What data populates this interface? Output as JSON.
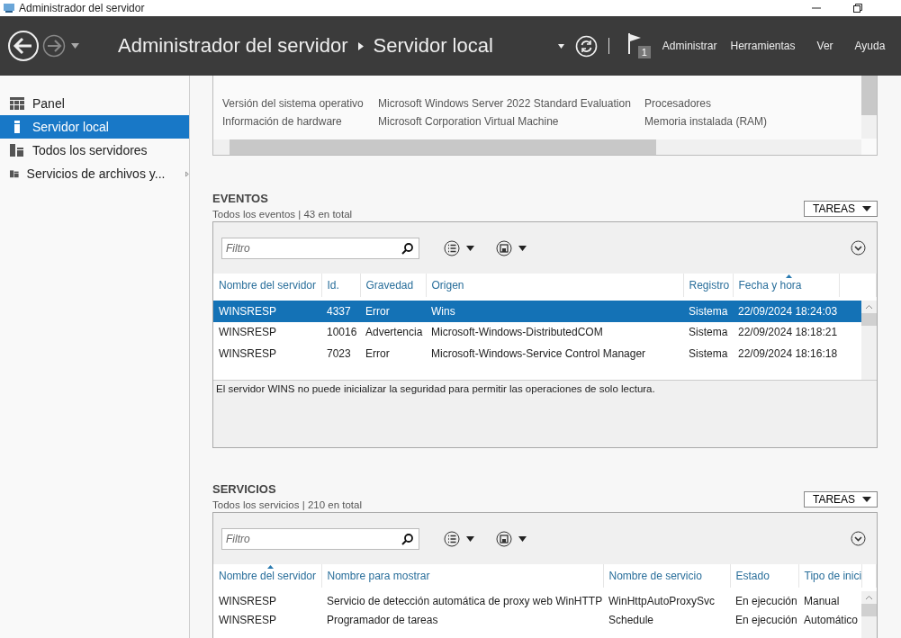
{
  "window": {
    "title": "Administrador del servidor"
  },
  "header": {
    "breadcrumb": [
      "Administrador del servidor",
      "Servidor local"
    ],
    "notification_count": "1",
    "menu": [
      "Administrar",
      "Herramientas",
      "Ver",
      "Ayuda"
    ]
  },
  "sidebar": {
    "items": [
      {
        "label": "Panel",
        "selected": false,
        "expandable": false
      },
      {
        "label": "Servidor local",
        "selected": true,
        "expandable": false
      },
      {
        "label": "Todos los servidores",
        "selected": false,
        "expandable": false
      },
      {
        "label": "Servicios de archivos y...",
        "selected": false,
        "expandable": true
      }
    ]
  },
  "properties": {
    "rows": [
      {
        "label": "Versión del sistema operativo",
        "value": "Microsoft Windows Server 2022 Standard Evaluation",
        "label_2": "Procesadores"
      },
      {
        "label": "Información de hardware",
        "value": "Microsoft Corporation Virtual Machine",
        "label_2": "Memoria instalada (RAM)"
      }
    ]
  },
  "events": {
    "title": "EVENTOS",
    "summary": "Todos los eventos | 43 en total",
    "tasks_button": "TAREAS",
    "filter": {
      "placeholder": "Filtro"
    },
    "columns": [
      {
        "label": "Nombre del servidor",
        "sorted": false
      },
      {
        "label": "Id.",
        "sorted": false
      },
      {
        "label": "Gravedad",
        "sorted": false
      },
      {
        "label": "Origen",
        "sorted": false
      },
      {
        "label": "Registro",
        "sorted": false
      },
      {
        "label": "Fecha y hora",
        "sorted": true
      }
    ],
    "rows": [
      {
        "selected": true,
        "cells": [
          "WINSRESP",
          "4337",
          "Error",
          "Wins",
          "Sistema",
          "22/09/2024 18:24:03"
        ]
      },
      {
        "selected": false,
        "cells": [
          "WINSRESP",
          "10016",
          "Advertencia",
          "Microsoft-Windows-DistributedCOM",
          "Sistema",
          "22/09/2024 18:18:21"
        ]
      },
      {
        "selected": false,
        "cells": [
          "WINSRESP",
          "7023",
          "Error",
          "Microsoft-Windows-Service Control Manager",
          "Sistema",
          "22/09/2024 18:16:18"
        ]
      }
    ],
    "detail": "El servidor WINS no puede inicializar la seguridad para permitir las operaciones de solo lectura."
  },
  "services": {
    "title": "SERVICIOS",
    "summary": "Todos los servicios | 210 en total",
    "tasks_button": "TAREAS",
    "filter": {
      "placeholder": "Filtro"
    },
    "columns": [
      {
        "label": "Nombre del servidor",
        "sorted": true
      },
      {
        "label": "Nombre para mostrar",
        "sorted": false
      },
      {
        "label": "Nombre de servicio",
        "sorted": false
      },
      {
        "label": "Estado",
        "sorted": false
      },
      {
        "label": "Tipo de inici",
        "sorted": false
      }
    ],
    "rows": [
      {
        "selected": false,
        "cells": [
          "WINSRESP",
          "Servicio de detección automática de proxy web WinHTTP",
          "WinHttpAutoProxySvc",
          "En ejecución",
          "Manual"
        ]
      },
      {
        "selected": false,
        "cells": [
          "WINSRESP",
          "Programador de tareas",
          "Schedule",
          "En ejecución",
          "Automático"
        ]
      }
    ]
  }
}
